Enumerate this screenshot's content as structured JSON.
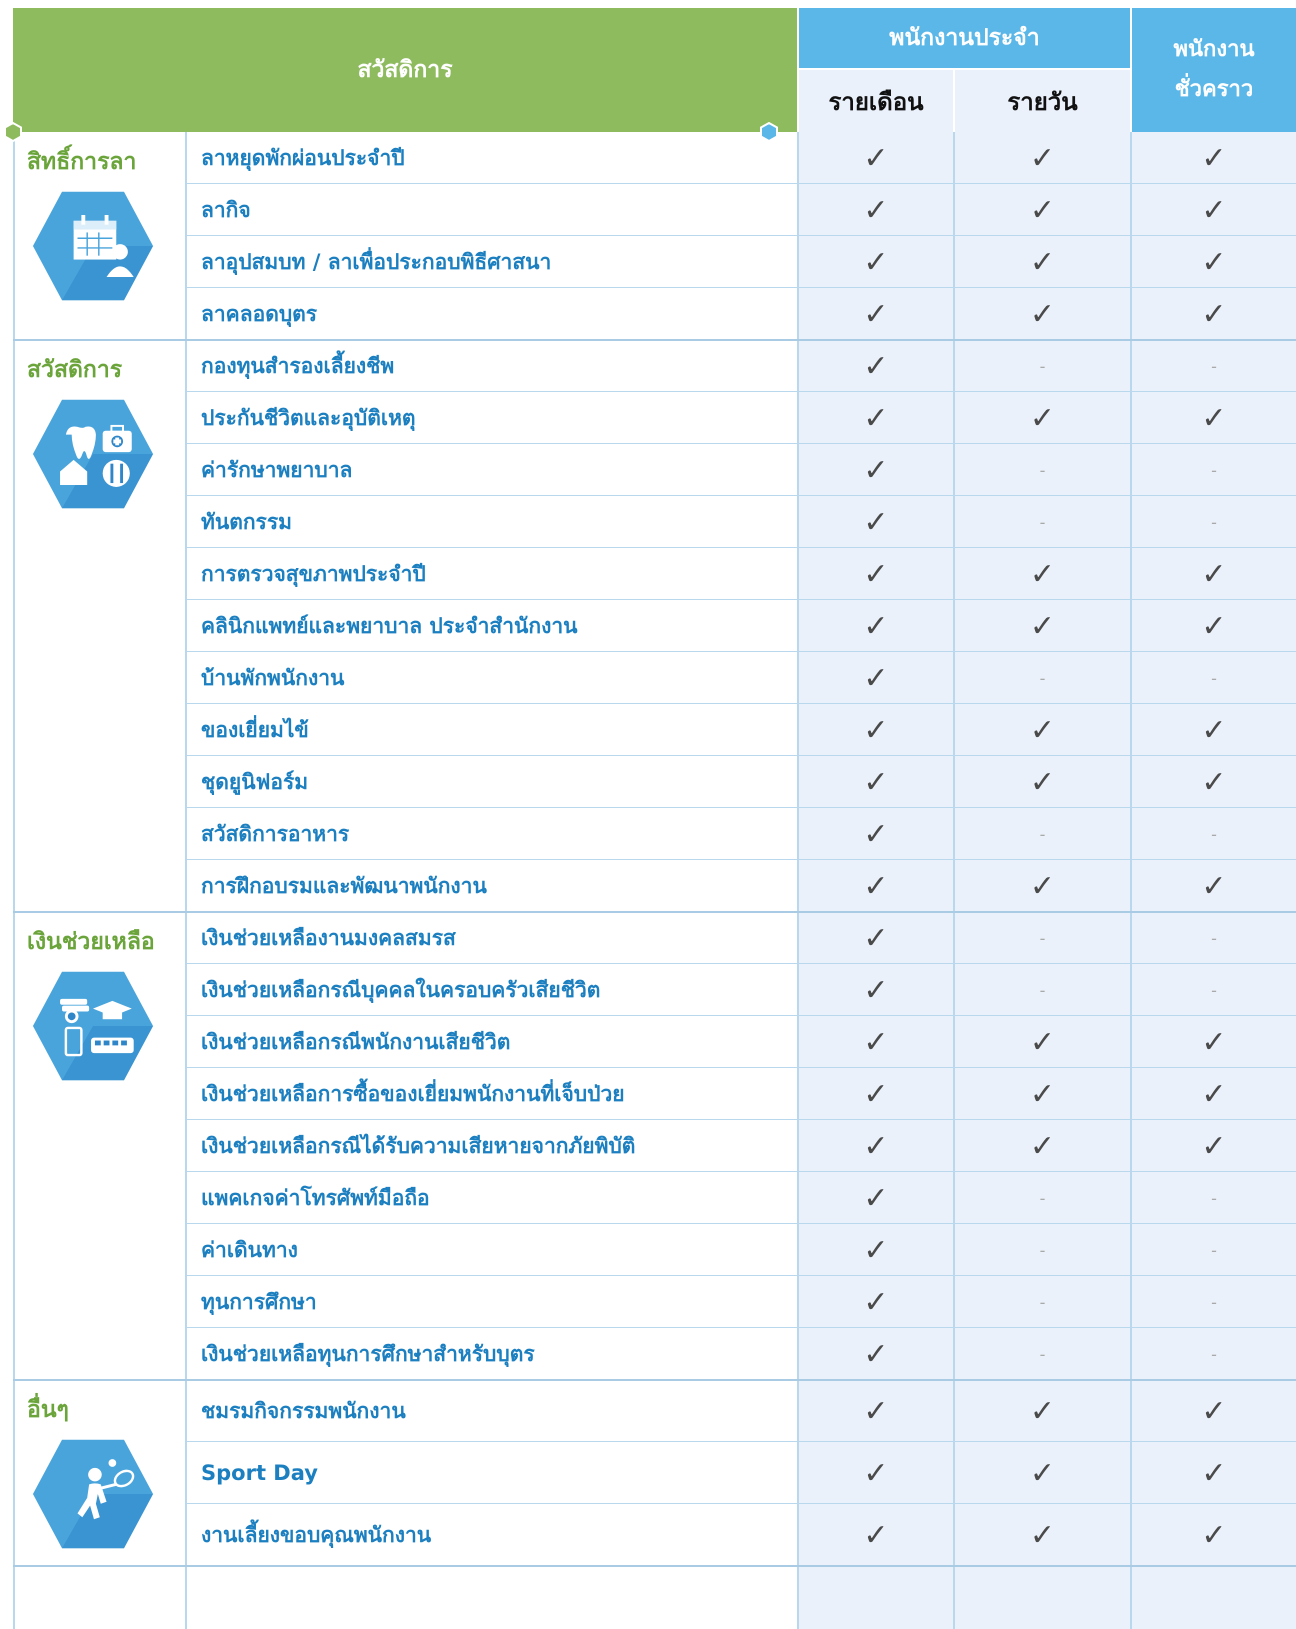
{
  "header": {
    "welfare": "สวัสดิการ",
    "permanent": "พนักงานประจำ",
    "monthly": "รายเดือน",
    "daily": "รายวัน",
    "temporary_line1": "พนักงาน",
    "temporary_line2": "ชั่วคราว"
  },
  "marks": {
    "check": "✓",
    "dash": "-"
  },
  "colors": {
    "green": "#8fbb5f",
    "blue": "#5bb7e8",
    "item_text": "#1b7fc0",
    "category_text": "#6aa43a"
  },
  "categories": [
    {
      "label": "สิทธิ์การลา",
      "icon": "calendar-person-icon",
      "items": [
        {
          "name": "ลาหยุดพักผ่อนประจำปี",
          "monthly": "check",
          "daily": "check",
          "temp": "check"
        },
        {
          "name": "ลากิจ",
          "monthly": "check",
          "daily": "check",
          "temp": "check"
        },
        {
          "name": "ลาอุปสมบท / ลาเพื่อประกอบพิธีศาสนา",
          "monthly": "check",
          "daily": "check",
          "temp": "check"
        },
        {
          "name": "ลาคลอดบุตร",
          "monthly": "check",
          "daily": "check",
          "temp": "check"
        }
      ]
    },
    {
      "label": "สวัสดิการ",
      "icon": "health-benefits-icon",
      "items": [
        {
          "name": "กองทุนสำรองเลี้ยงชีพ",
          "monthly": "check",
          "daily": "dash",
          "temp": "dash"
        },
        {
          "name": "ประกันชีวิตและอุบัติเหตุ",
          "monthly": "check",
          "daily": "check",
          "temp": "check"
        },
        {
          "name": "ค่ารักษาพยาบาล",
          "monthly": "check",
          "daily": "dash",
          "temp": "dash"
        },
        {
          "name": "ทันตกรรม",
          "monthly": "check",
          "daily": "dash",
          "temp": "dash"
        },
        {
          "name": "การตรวจสุขภาพประจำปี",
          "monthly": "check",
          "daily": "check",
          "temp": "check"
        },
        {
          "name": "คลินิกแพทย์และพยาบาล ประจำสำนักงาน",
          "monthly": "check",
          "daily": "check",
          "temp": "check"
        },
        {
          "name": "บ้านพักพนักงาน",
          "monthly": "check",
          "daily": "dash",
          "temp": "dash"
        },
        {
          "name": "ของเยี่ยมไข้",
          "monthly": "check",
          "daily": "check",
          "temp": "check"
        },
        {
          "name": "ชุดยูนิฟอร์ม",
          "monthly": "check",
          "daily": "check",
          "temp": "check"
        },
        {
          "name": "สวัสดิการอาหาร",
          "monthly": "check",
          "daily": "dash",
          "temp": "dash"
        },
        {
          "name": "การฝึกอบรมและพัฒนาพนักงาน",
          "monthly": "check",
          "daily": "check",
          "temp": "check"
        }
      ]
    },
    {
      "label": "เงินช่วยเหลือ",
      "icon": "financial-aid-icon",
      "items": [
        {
          "name": "เงินช่วยเหลืองานมงคลสมรส",
          "monthly": "check",
          "daily": "dash",
          "temp": "dash"
        },
        {
          "name": "เงินช่วยเหลือกรณีบุคคลในครอบครัวเสียชีวิต",
          "monthly": "check",
          "daily": "dash",
          "temp": "dash"
        },
        {
          "name": "เงินช่วยเหลือกรณีพนักงานเสียชีวิต",
          "monthly": "check",
          "daily": "check",
          "temp": "check"
        },
        {
          "name": "เงินช่วยเหลือการซื้อของเยี่ยมพนักงานที่เจ็บป่วย",
          "monthly": "check",
          "daily": "check",
          "temp": "check"
        },
        {
          "name": "เงินช่วยเหลือกรณีได้รับความเสียหายจากภัยพิบัติ",
          "monthly": "check",
          "daily": "check",
          "temp": "check"
        },
        {
          "name": "แพคเกจค่าโทรศัพท์มือถือ",
          "monthly": "check",
          "daily": "dash",
          "temp": "dash"
        },
        {
          "name": "ค่าเดินทาง",
          "monthly": "check",
          "daily": "dash",
          "temp": "dash"
        },
        {
          "name": "ทุนการศึกษา",
          "monthly": "check",
          "daily": "dash",
          "temp": "dash"
        },
        {
          "name": "เงินช่วยเหลือทุนการศึกษาสำหรับบุตร",
          "monthly": "check",
          "daily": "dash",
          "temp": "dash"
        }
      ]
    },
    {
      "label": "อื่นๆ",
      "icon": "tennis-player-icon",
      "items": [
        {
          "name": "ชมรมกิจกรรมพนักงาน",
          "monthly": "check",
          "daily": "check",
          "temp": "check"
        },
        {
          "name": "Sport Day",
          "monthly": "check",
          "daily": "check",
          "temp": "check"
        },
        {
          "name": "งานเลี้ยงขอบคุณพนักงาน",
          "monthly": "check",
          "daily": "check",
          "temp": "check"
        }
      ]
    }
  ]
}
